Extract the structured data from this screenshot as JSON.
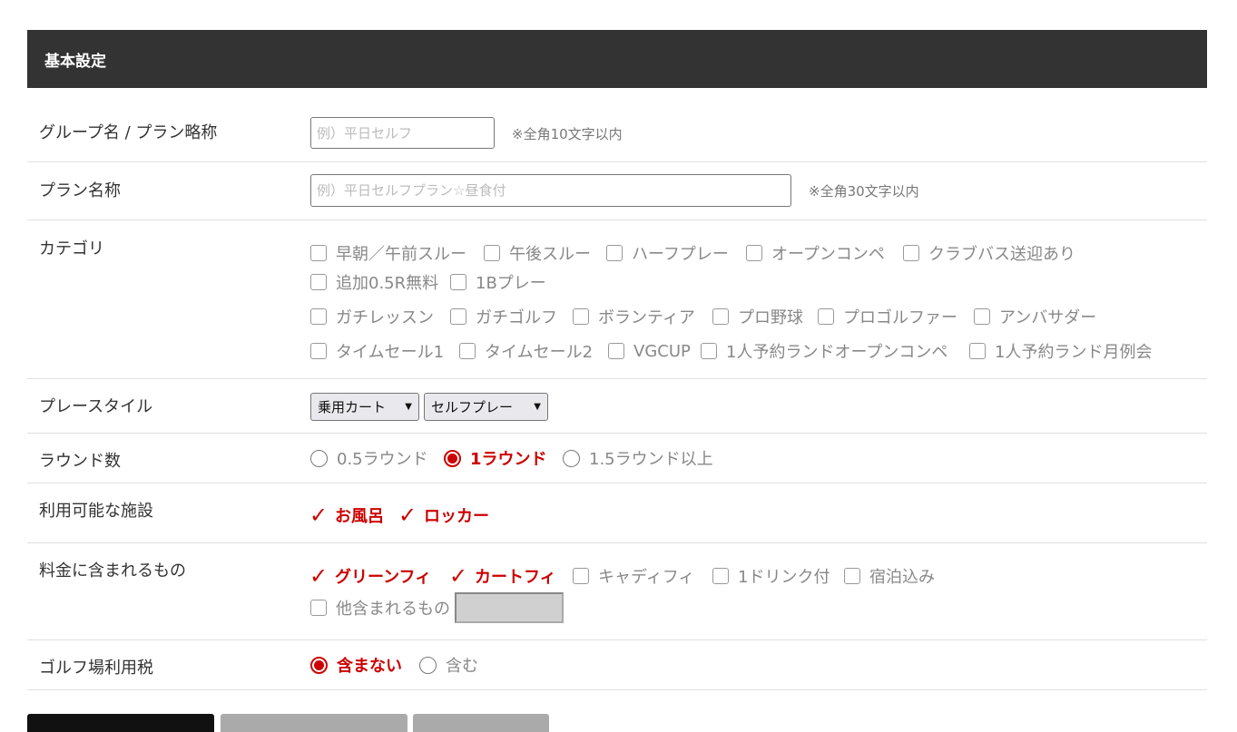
{
  "section": {
    "title": "基本設定"
  },
  "group_name": {
    "label": "グループ名 / プラン略称",
    "placeholder": "例）平日セルフ",
    "hint": "※全角10文字以内"
  },
  "plan_name": {
    "label": "プラン名称",
    "placeholder": "例）平日セルフプラン☆昼食付",
    "hint": "※全角30文字以内"
  },
  "category": {
    "label": "カテゴリ",
    "options": [
      {
        "label": "早朝／午前スルー",
        "checked": false
      },
      {
        "label": "午後スルー",
        "checked": false
      },
      {
        "label": "ハーフプレー",
        "checked": false
      },
      {
        "label": "オープンコンペ",
        "checked": false
      },
      {
        "label": "クラブバス送迎あり",
        "checked": false
      },
      {
        "label": "追加0.5R無料",
        "checked": false
      },
      {
        "label": "1Bプレー",
        "checked": false
      },
      {
        "label": "ガチレッスン",
        "checked": false
      },
      {
        "label": "ガチゴルフ",
        "checked": false
      },
      {
        "label": "ボランティア",
        "checked": false
      },
      {
        "label": "プロ野球",
        "checked": false
      },
      {
        "label": "プロゴルファー",
        "checked": false
      },
      {
        "label": "アンバサダー",
        "checked": false
      },
      {
        "label": "タイムセール1",
        "checked": false
      },
      {
        "label": "タイムセール2",
        "checked": false
      },
      {
        "label": "VGCUP",
        "checked": false
      },
      {
        "label": "1人予約ランドオープンコンペ",
        "checked": false
      },
      {
        "label": "1人予約ランド月例会",
        "checked": false
      }
    ]
  },
  "play_style": {
    "label": "プレースタイル",
    "cart_select": "乗用カート",
    "play_select": "セルフプレー"
  },
  "rounds": {
    "label": "ラウンド数",
    "options": [
      {
        "label": "0.5ラウンド",
        "selected": false
      },
      {
        "label": "1ラウンド",
        "selected": true
      },
      {
        "label": "1.5ラウンド以上",
        "selected": false
      }
    ]
  },
  "facilities": {
    "label": "利用可能な施設",
    "options": [
      {
        "label": "お風呂",
        "checked": true
      },
      {
        "label": "ロッカー",
        "checked": true
      }
    ]
  },
  "included": {
    "label": "料金に含まれるもの",
    "options": [
      {
        "label": "グリーンフィ",
        "checked": true
      },
      {
        "label": "カートフィ",
        "checked": true
      },
      {
        "label": "キャディフィ",
        "checked": false
      },
      {
        "label": "1ドリンク付",
        "checked": false
      },
      {
        "label": "宿泊込み",
        "checked": false
      },
      {
        "label": "他含まれるもの",
        "checked": false
      }
    ],
    "other_value": ""
  },
  "golf_tax": {
    "label": "ゴルフ場利用税",
    "options": [
      {
        "label": "含まない",
        "selected": true
      },
      {
        "label": "含む",
        "selected": false
      }
    ]
  },
  "colors": {
    "accent": "#cc0000",
    "header_bg": "#333333",
    "dark_button": "#111111",
    "grey_button": "#aaaaaa"
  }
}
